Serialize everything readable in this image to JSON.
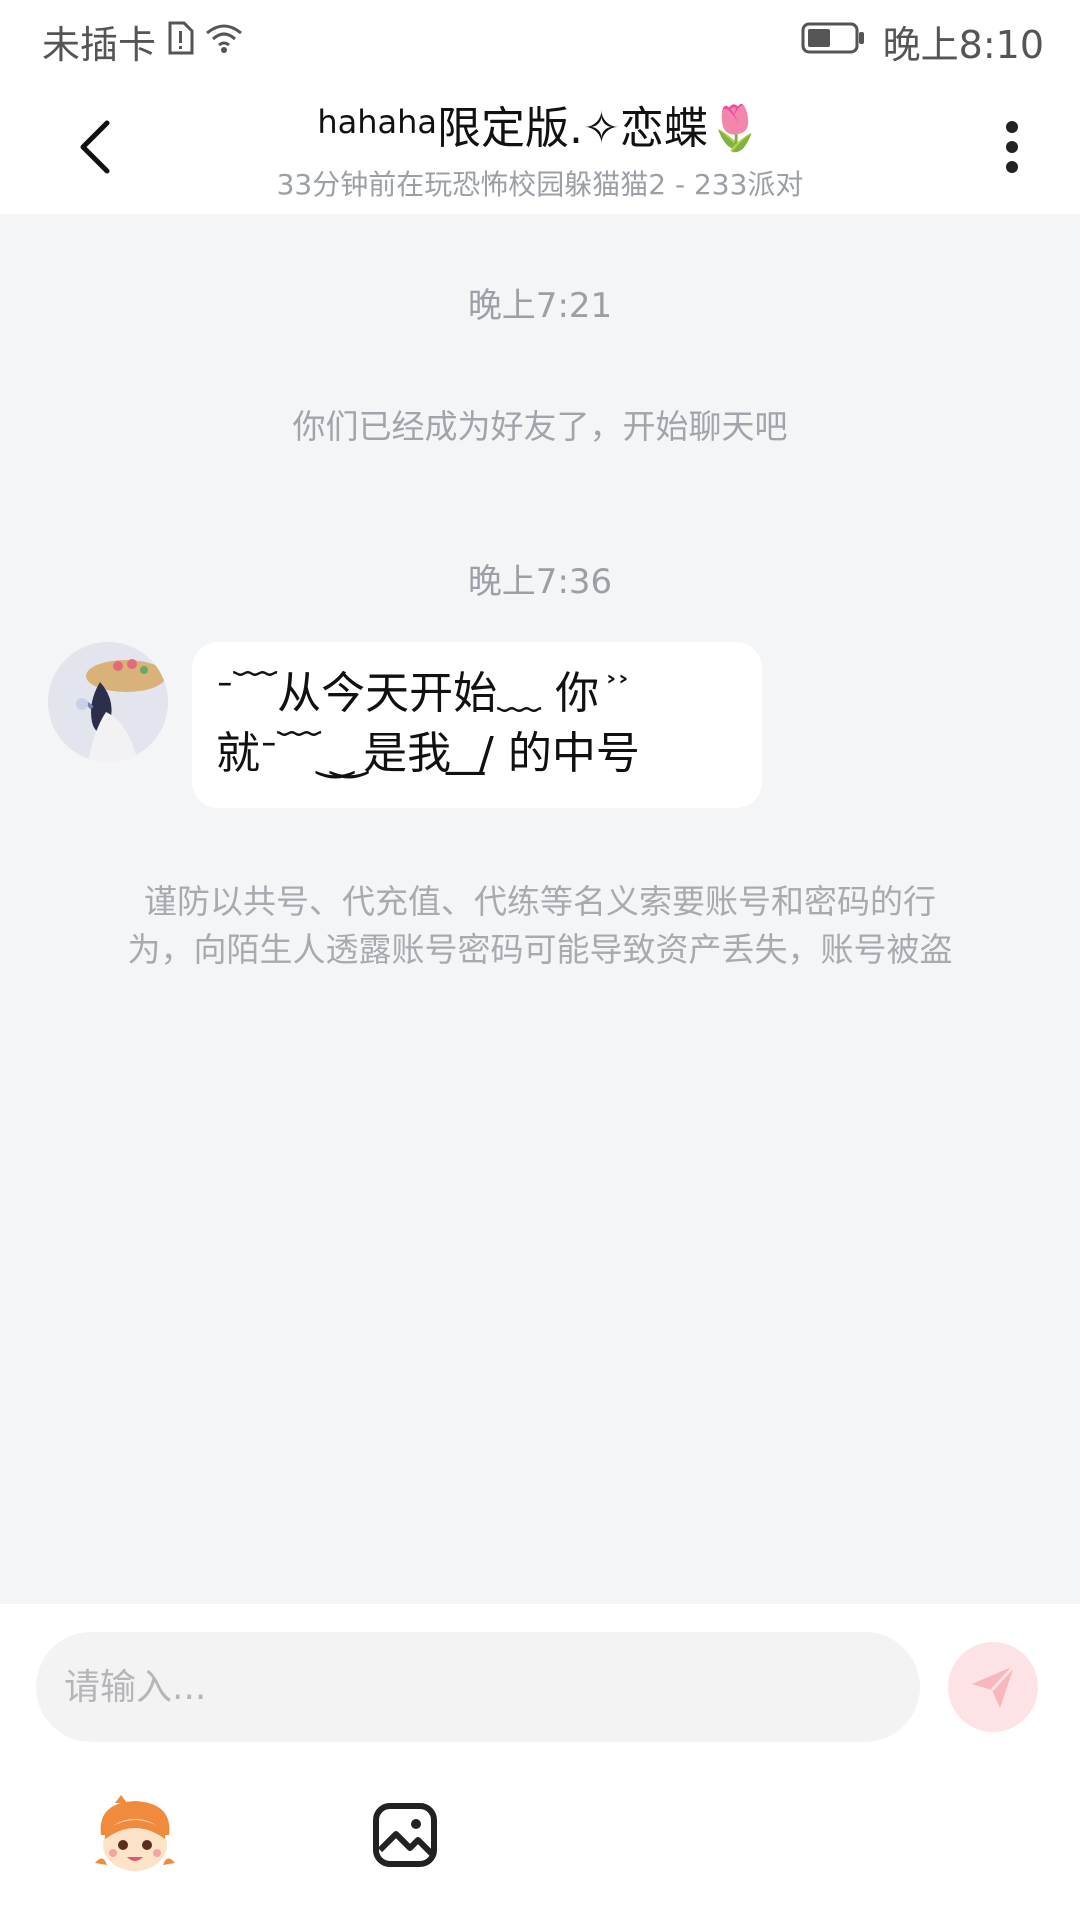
{
  "status_bar": {
    "carrier": "未插卡",
    "time": "晚上8:10"
  },
  "header": {
    "title_prefix": "hahaha",
    "title_main": "限定版.✧恋蝶🌷",
    "subtitle": "33分钟前在玩恐怖校园躲猫猫2 - 233派对"
  },
  "chat": {
    "timestamp_1": "晚上7:21",
    "system_message": "你们已经成为好友了，开始聊天吧",
    "timestamp_2": "晚上7:36",
    "message_line_1": "ᐨ﹋从今天开始﹏ 你 ͐ ͐",
    "message_line_2": "就ᐨ﹋ ͜ ͜ 是我 ͟ / 的中号",
    "warning_line_1": "谨防以共号、代充值、代练等名义索要账号和密码的行",
    "warning_line_2": "为，向陌生人透露账号密码可能导致资产丢失，账号被盗"
  },
  "composer": {
    "placeholder": "请输入..."
  },
  "colors": {
    "chat_background": "#f4f5f7",
    "send_button": "#fde3e5",
    "send_icon": "#f7b7bc"
  }
}
